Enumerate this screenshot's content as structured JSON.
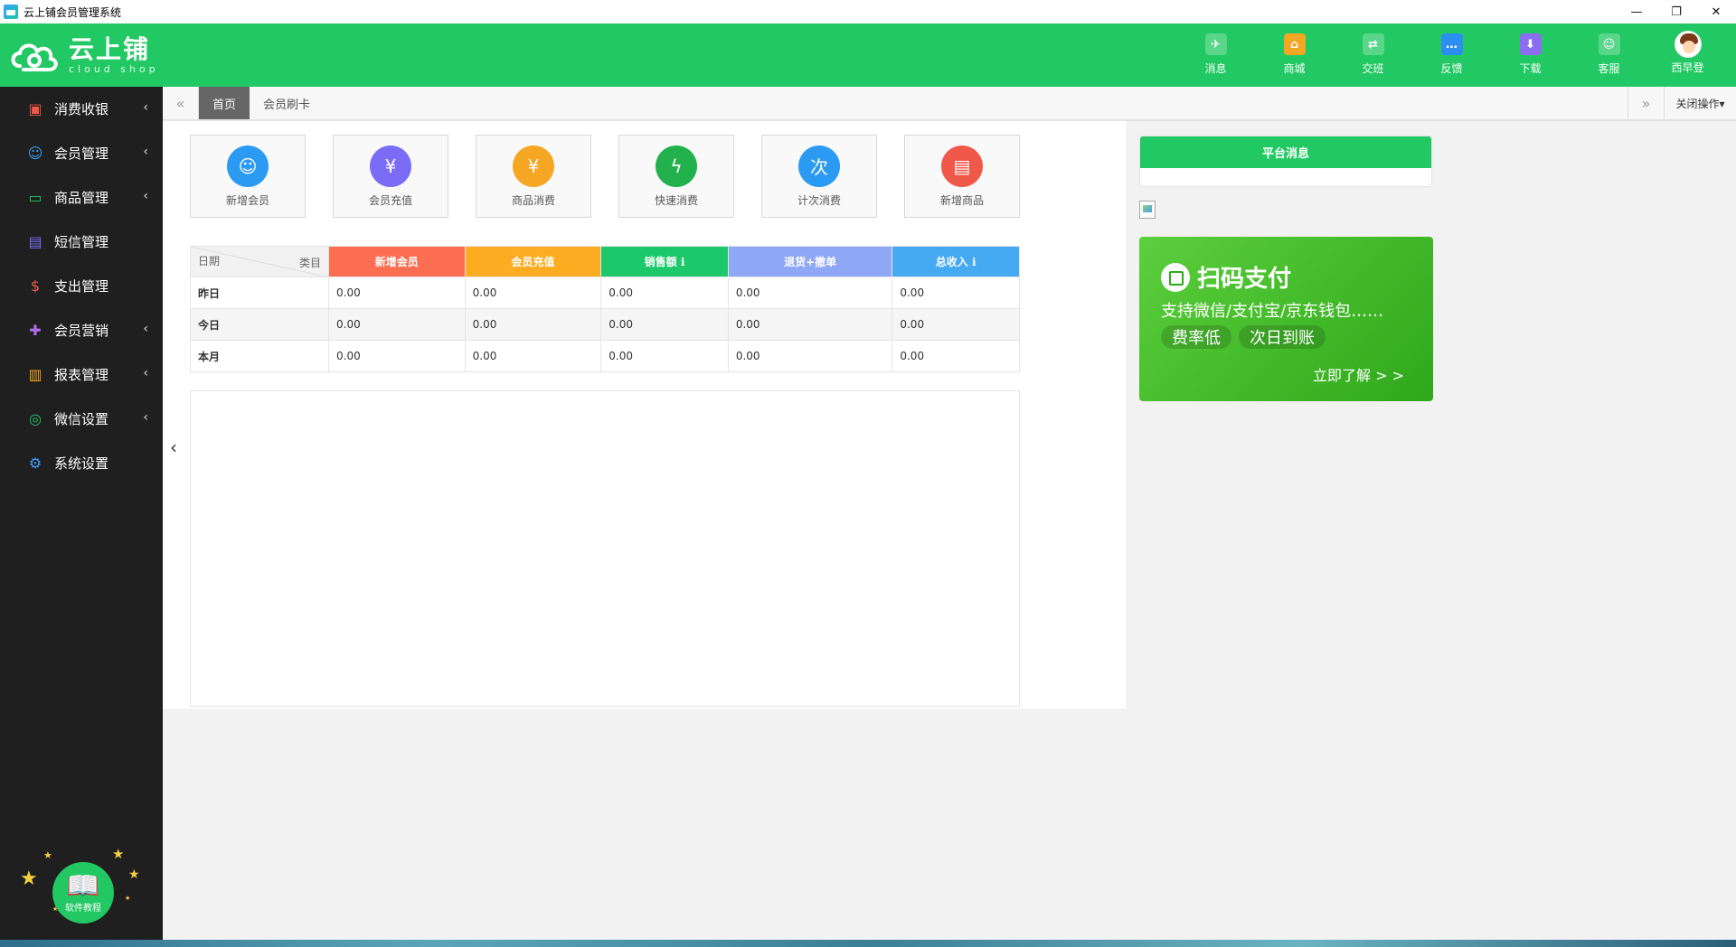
{
  "window": {
    "title": "云上铺会员管理系统",
    "minimize": "—",
    "restore": "❐",
    "close": "✕"
  },
  "brand": {
    "name": "云上铺",
    "sub": "cloud shop"
  },
  "topnav": [
    {
      "label": "消息",
      "icon": "message-icon",
      "color": "#ffffff",
      "glyph": "✈"
    },
    {
      "label": "商城",
      "icon": "store-icon",
      "color": "#f5a623",
      "glyph": "⌂"
    },
    {
      "label": "交班",
      "icon": "handover-icon",
      "color": "#ffffff",
      "glyph": "⇄"
    },
    {
      "label": "反馈",
      "icon": "feedback-icon",
      "color": "#2b8ef0",
      "glyph": "…"
    },
    {
      "label": "下载",
      "icon": "download-icon",
      "color": "#8c6cf0",
      "glyph": "⬇"
    },
    {
      "label": "客服",
      "icon": "service-icon",
      "color": "#ffffff",
      "glyph": "☺"
    },
    {
      "label": "西早登",
      "icon": "user-avatar"
    }
  ],
  "sidebar": {
    "items": [
      {
        "label": "消费收银",
        "icon": "cashier-icon",
        "color": "#f0594a",
        "glyph": "▣",
        "arrow": "‹"
      },
      {
        "label": "会员管理",
        "icon": "member-icon",
        "color": "#3aa0ff",
        "glyph": "☺",
        "arrow": "‹"
      },
      {
        "label": "商品管理",
        "icon": "goods-icon",
        "color": "#22c863",
        "glyph": "▭",
        "arrow": "‹"
      },
      {
        "label": "短信管理",
        "icon": "sms-icon",
        "color": "#7b6cf6",
        "glyph": "▤",
        "arrow": ""
      },
      {
        "label": "支出管理",
        "icon": "expense-icon",
        "color": "#f0594a",
        "glyph": "$",
        "arrow": ""
      },
      {
        "label": "会员营销",
        "icon": "marketing-icon",
        "color": "#b36cf0",
        "glyph": "✚",
        "arrow": "‹"
      },
      {
        "label": "报表管理",
        "icon": "report-icon",
        "color": "#f5a623",
        "glyph": "▥",
        "arrow": "‹"
      },
      {
        "label": "微信设置",
        "icon": "wechat-icon",
        "color": "#22c863",
        "glyph": "◎",
        "arrow": "‹"
      },
      {
        "label": "系统设置",
        "icon": "settings-icon",
        "color": "#3aa0ff",
        "glyph": "⚙",
        "arrow": ""
      }
    ],
    "tutorial_label": "软件教程"
  },
  "tabs": {
    "prev": "«",
    "next": "»",
    "items": [
      "首页",
      "会员刷卡"
    ],
    "close_ops": "关闭操作▾"
  },
  "shortcuts": [
    {
      "label": "新增会员",
      "icon": "add-member-icon",
      "color": "#2b9af3",
      "glyph": "☺"
    },
    {
      "label": "会员充值",
      "icon": "recharge-icon",
      "color": "#7b6cf6",
      "glyph": "¥"
    },
    {
      "label": "商品消费",
      "icon": "goods-consume-icon",
      "color": "#f5a623",
      "glyph": "¥"
    },
    {
      "label": "快速消费",
      "icon": "quick-consume-icon",
      "color": "#22b14c",
      "glyph": "ϟ"
    },
    {
      "label": "计次消费",
      "icon": "count-consume-icon",
      "color": "#2b9af3",
      "glyph": "次"
    },
    {
      "label": "新增商品",
      "icon": "add-goods-icon",
      "color": "#f0594a",
      "glyph": "▤"
    }
  ],
  "stats": {
    "corner_date": "日期",
    "corner_category": "类目",
    "columns": [
      {
        "label": "新增会员",
        "color": "#fb6e52"
      },
      {
        "label": "会员充值",
        "color": "#fbac21"
      },
      {
        "label": "销售额 ℹ",
        "color": "#1dc86b"
      },
      {
        "label": "退货+撤单",
        "color": "#8fa8f6"
      },
      {
        "label": "总收入 ℹ",
        "color": "#45aaf2"
      }
    ],
    "rows": [
      {
        "label": "昨日",
        "values": [
          "0.00",
          "0.00",
          "0.00",
          "0.00",
          "0.00"
        ]
      },
      {
        "label": "今日",
        "values": [
          "0.00",
          "0.00",
          "0.00",
          "0.00",
          "0.00"
        ]
      },
      {
        "label": "本月",
        "values": [
          "0.00",
          "0.00",
          "0.00",
          "0.00",
          "0.00"
        ]
      }
    ]
  },
  "notice": {
    "title": "平台消息"
  },
  "pay_banner": {
    "title": "扫码支付",
    "subtitle": "支持微信/支付宝/京东钱包……",
    "tags": [
      "费率低",
      "次日到账"
    ],
    "more": "立即了解 > >"
  },
  "colors": {
    "brand_green": "#22c863",
    "sidebar_bg": "#1f1f1f"
  }
}
